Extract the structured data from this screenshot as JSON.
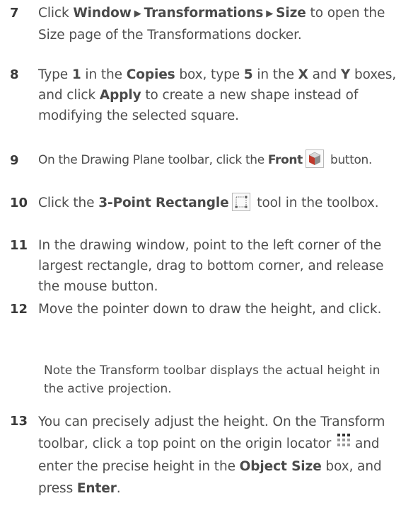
{
  "steps": {
    "s7": {
      "num": "7",
      "p1": "Click ",
      "b1": "Window",
      "b2": "Transformations",
      "b3": "Size",
      "p2": " to open the Size page of the Transformations docker."
    },
    "s8": {
      "num": "8",
      "p1": "Type ",
      "b1": "1",
      "p2": " in the ",
      "b2": "Copies",
      "p3": " box, type ",
      "b3": "5",
      "p4": " in the ",
      "b4": "X",
      "p5": " and ",
      "b5": "Y",
      "p6": " boxes, and click ",
      "b6": "Apply",
      "p7": " to create a new shape instead of modifying the selected square."
    },
    "s9": {
      "num": "9",
      "p1": "On the Drawing Plane toolbar, click the ",
      "b1": "Front",
      "p2": " button."
    },
    "s10": {
      "num": "10",
      "p1": "Click the ",
      "b1": "3-Point Rectangle",
      "p2": " tool in the toolbox."
    },
    "s11": {
      "num": "11",
      "p1": "In the drawing window, point to the left corner of the largest rectangle, drag to bottom corner, and release the mouse button."
    },
    "s12": {
      "num": "12",
      "p1": "Move the pointer down to draw the height, and click."
    },
    "note": "Note the Transform toolbar displays the actual height in the active projection.",
    "s13": {
      "num": "13",
      "p1": "You can precisely adjust the height. On the Transform toolbar, click a top point on the origin locator",
      "p2": " and enter the precise height in the ",
      "b1": "Object Size",
      "p3": " box, and press ",
      "b2": "Enter",
      "p4": "."
    }
  },
  "icons": {
    "menu_arrow": "▶",
    "front": "front-plane-cube-icon",
    "rect3": "3-point-rectangle-icon",
    "origin": "origin-locator-icon"
  }
}
